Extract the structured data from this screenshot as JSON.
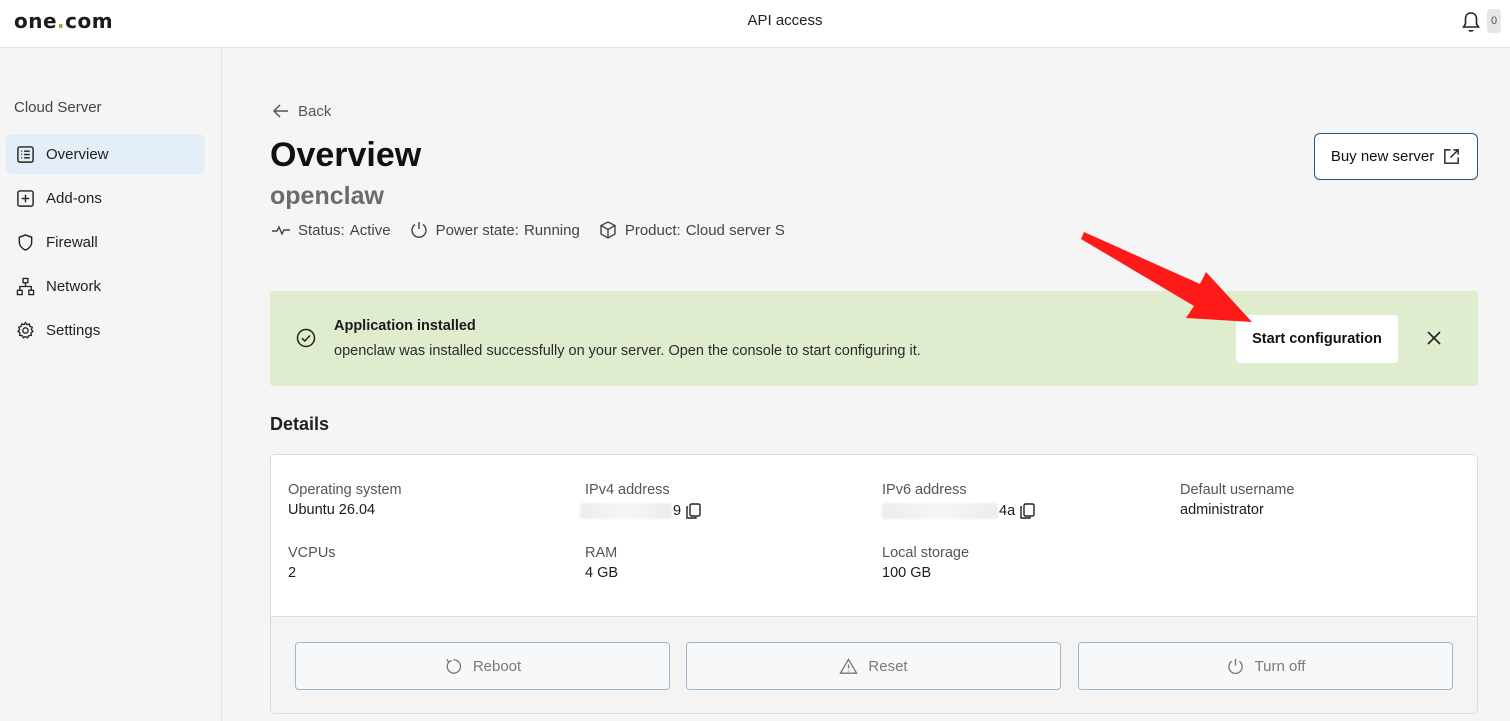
{
  "topbar": {
    "logo_left": "one",
    "logo_dot": ".",
    "logo_right": "com",
    "title": "API access",
    "notification_count": "0"
  },
  "sidebar": {
    "title": "Cloud Server",
    "items": [
      {
        "label": "Overview",
        "icon": "list-icon",
        "active": true
      },
      {
        "label": "Add-ons",
        "icon": "plus-square-icon"
      },
      {
        "label": "Firewall",
        "icon": "shield-icon"
      },
      {
        "label": "Network",
        "icon": "network-icon"
      },
      {
        "label": "Settings",
        "icon": "gear-icon"
      }
    ]
  },
  "main": {
    "back_label": "Back",
    "title": "Overview",
    "server_name": "openclaw",
    "status": {
      "status_label": "Status:",
      "status_value": "Active",
      "power_label": "Power state:",
      "power_value": "Running",
      "product_label": "Product:",
      "product_value": "Cloud server S"
    },
    "buy_button": "Buy new server"
  },
  "banner": {
    "title": "Application installed",
    "text": "openclaw was installed successfully on your server. Open the console to start configuring it.",
    "action": "Start configuration",
    "background": "#dfecce"
  },
  "details": {
    "heading": "Details",
    "fields": {
      "os": {
        "label": "Operating system",
        "value": "Ubuntu 26.04"
      },
      "ipv4": {
        "label": "IPv4 address",
        "value_visible": "9"
      },
      "ipv6": {
        "label": "IPv6 address",
        "value_visible": "4a"
      },
      "username": {
        "label": "Default username",
        "value": "administrator"
      },
      "vcpus": {
        "label": "VCPUs",
        "value": "2"
      },
      "ram": {
        "label": "RAM",
        "value": "4 GB"
      },
      "storage": {
        "label": "Local storage",
        "value": "100 GB"
      }
    },
    "actions": {
      "reboot": "Reboot",
      "reset": "Reset",
      "turn_off": "Turn off"
    }
  },
  "colors": {
    "accent_border": "#1c5a8a",
    "active_nav": "#e3eef8",
    "annotation_arrow": "#ff1a1a"
  }
}
